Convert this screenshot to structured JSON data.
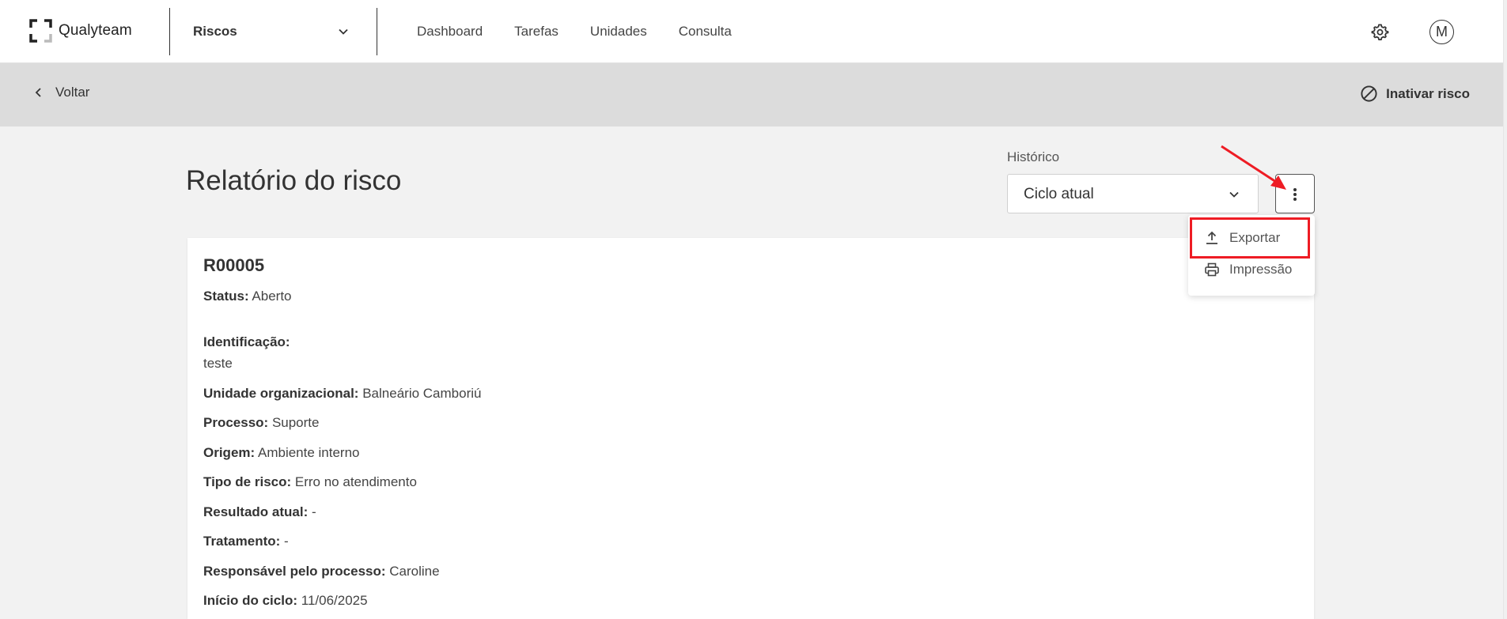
{
  "header": {
    "brand": "Qualyteam",
    "module": "Riscos",
    "nav": [
      "Dashboard",
      "Tarefas",
      "Unidades",
      "Consulta"
    ],
    "avatar_initial": "M"
  },
  "subbar": {
    "back_label": "Voltar",
    "inactivate_label": "Inativar risco"
  },
  "page": {
    "title": "Relatório do risco",
    "history_label": "Histórico",
    "history_value": "Ciclo atual"
  },
  "menu": {
    "export_label": "Exportar",
    "print_label": "Impressão"
  },
  "report": {
    "code": "R00005",
    "status_label": "Status:",
    "status_value": "Aberto",
    "identification_label": "Identificação:",
    "identification_value": "teste",
    "fields": [
      {
        "label": "Unidade organizacional:",
        "value": "Balneário Camboriú"
      },
      {
        "label": "Processo:",
        "value": "Suporte"
      },
      {
        "label": "Origem:",
        "value": "Ambiente interno"
      },
      {
        "label": "Tipo de risco:",
        "value": "Erro no atendimento"
      },
      {
        "label": "Resultado atual:",
        "value": "-"
      },
      {
        "label": "Tratamento:",
        "value": "-"
      },
      {
        "label": "Responsável pelo processo:",
        "value": "Caroline"
      },
      {
        "label": "Início do ciclo:",
        "value": "11/06/2025"
      }
    ]
  },
  "colors": {
    "annotation_red": "#ee1c24",
    "subbar_bg": "#dcdcdc",
    "page_bg": "#f2f2f2"
  }
}
